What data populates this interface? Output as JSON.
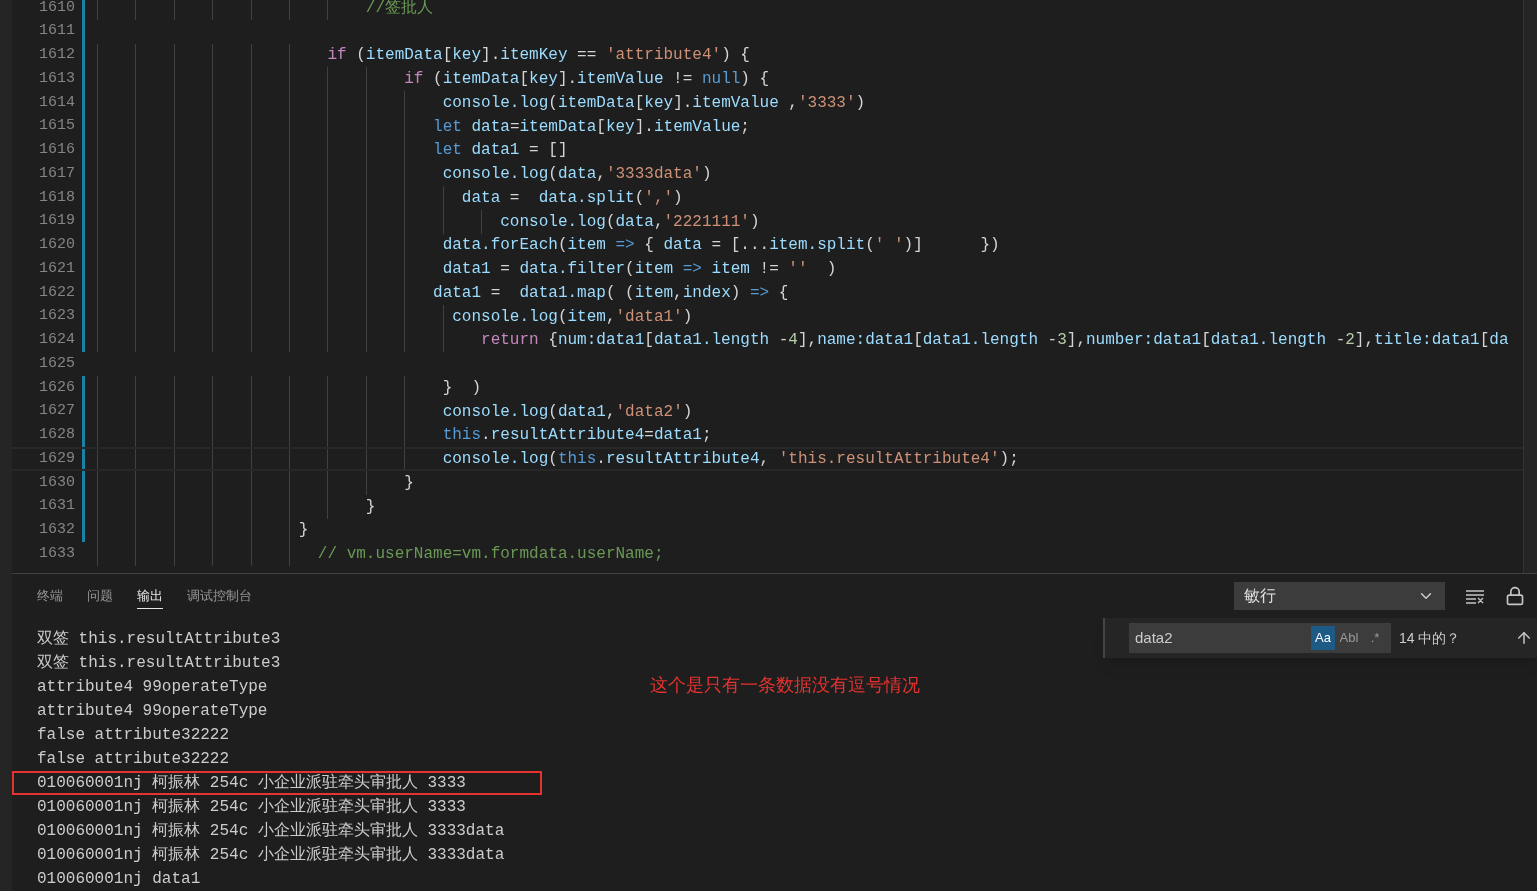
{
  "editor": {
    "lines": [
      {
        "n": "1610",
        "modified": true,
        "current": false,
        "code": [
          {
            "kind": "com",
            "text": "                            //签批人"
          }
        ]
      },
      {
        "n": "1611",
        "modified": true,
        "current": false
      },
      {
        "n": "1612",
        "modified": true,
        "current": false,
        "code": [
          {
            "kind": "kw",
            "text": "                        if"
          },
          {
            "kind": "p",
            "text": " ("
          },
          {
            "kind": "id",
            "text": "itemData"
          },
          {
            "kind": "p",
            "text": "["
          },
          {
            "kind": "id",
            "text": "key"
          },
          {
            "kind": "p",
            "text": "]."
          },
          {
            "kind": "id",
            "text": "itemKey"
          },
          {
            "kind": "p",
            "text": " == "
          },
          {
            "kind": "str",
            "text": "'attribute4'"
          },
          {
            "kind": "p",
            "text": ") {"
          }
        ]
      },
      {
        "n": "1613",
        "modified": true,
        "current": false,
        "code": [
          {
            "kind": "kw",
            "text": "                                if"
          },
          {
            "kind": "p",
            "text": " ("
          },
          {
            "kind": "id",
            "text": "itemData"
          },
          {
            "kind": "p",
            "text": "["
          },
          {
            "kind": "id",
            "text": "key"
          },
          {
            "kind": "p",
            "text": "]."
          },
          {
            "kind": "id",
            "text": "itemValue"
          },
          {
            "kind": "p",
            "text": " != "
          },
          {
            "kind": "dk",
            "text": "null"
          },
          {
            "kind": "p",
            "text": ") {"
          }
        ]
      },
      {
        "n": "1614",
        "modified": true,
        "current": false,
        "code": [
          {
            "kind": "id",
            "text": "                                    console.log"
          },
          {
            "kind": "p",
            "text": "("
          },
          {
            "kind": "id",
            "text": "itemData"
          },
          {
            "kind": "p",
            "text": "["
          },
          {
            "kind": "id",
            "text": "key"
          },
          {
            "kind": "p",
            "text": "]."
          },
          {
            "kind": "id",
            "text": "itemValue"
          },
          {
            "kind": "p",
            "text": " ,"
          },
          {
            "kind": "str",
            "text": "'3333'"
          },
          {
            "kind": "p",
            "text": ")"
          }
        ]
      },
      {
        "n": "1615",
        "modified": true,
        "current": false,
        "code": [
          {
            "kind": "dk",
            "text": "                                   let"
          },
          {
            "kind": "id",
            "text": " data"
          },
          {
            "kind": "p",
            "text": "="
          },
          {
            "kind": "id",
            "text": "itemData"
          },
          {
            "kind": "p",
            "text": "["
          },
          {
            "kind": "id",
            "text": "key"
          },
          {
            "kind": "p",
            "text": "]."
          },
          {
            "kind": "id",
            "text": "itemValue"
          },
          {
            "kind": "p",
            "text": ";"
          }
        ]
      },
      {
        "n": "1616",
        "modified": true,
        "current": false,
        "code": [
          {
            "kind": "dk",
            "text": "                                   let"
          },
          {
            "kind": "id",
            "text": " data1"
          },
          {
            "kind": "p",
            "text": " = []"
          }
        ]
      },
      {
        "n": "1617",
        "modified": true,
        "current": false,
        "code": [
          {
            "kind": "id",
            "text": "                                    console.log"
          },
          {
            "kind": "p",
            "text": "("
          },
          {
            "kind": "id",
            "text": "data"
          },
          {
            "kind": "p",
            "text": ","
          },
          {
            "kind": "str",
            "text": "'3333data'"
          },
          {
            "kind": "p",
            "text": ")"
          }
        ]
      },
      {
        "n": "1618",
        "modified": true,
        "current": false,
        "code": [
          {
            "kind": "id",
            "text": "                                      data"
          },
          {
            "kind": "p",
            "text": " =  "
          },
          {
            "kind": "id",
            "text": "data.split"
          },
          {
            "kind": "p",
            "text": "("
          },
          {
            "kind": "str",
            "text": "','"
          },
          {
            "kind": "p",
            "text": ")"
          }
        ]
      },
      {
        "n": "1619",
        "modified": true,
        "current": false,
        "code": [
          {
            "kind": "id",
            "text": "                                          console.log"
          },
          {
            "kind": "p",
            "text": "("
          },
          {
            "kind": "id",
            "text": "data"
          },
          {
            "kind": "p",
            "text": ","
          },
          {
            "kind": "str",
            "text": "'2221111'"
          },
          {
            "kind": "p",
            "text": ")"
          }
        ]
      },
      {
        "n": "1620",
        "modified": true,
        "current": false,
        "code": [
          {
            "kind": "id",
            "text": "                                    data.forEach"
          },
          {
            "kind": "p",
            "text": "("
          },
          {
            "kind": "id",
            "text": "item"
          },
          {
            "kind": "dk",
            "text": " =>"
          },
          {
            "kind": "p",
            "text": " { "
          },
          {
            "kind": "id",
            "text": "data"
          },
          {
            "kind": "p",
            "text": " = [..."
          },
          {
            "kind": "id",
            "text": "item.split"
          },
          {
            "kind": "p",
            "text": "("
          },
          {
            "kind": "str",
            "text": "' '"
          },
          {
            "kind": "p",
            "text": ")]      })"
          }
        ]
      },
      {
        "n": "1621",
        "modified": true,
        "current": false,
        "code": [
          {
            "kind": "id",
            "text": "                                    data1"
          },
          {
            "kind": "p",
            "text": " = "
          },
          {
            "kind": "id",
            "text": "data.filter"
          },
          {
            "kind": "p",
            "text": "("
          },
          {
            "kind": "id",
            "text": "item"
          },
          {
            "kind": "dk",
            "text": " =>"
          },
          {
            "kind": "id",
            "text": " item"
          },
          {
            "kind": "p",
            "text": " != "
          },
          {
            "kind": "str",
            "text": "''"
          },
          {
            "kind": "p",
            "text": "  )"
          }
        ]
      },
      {
        "n": "1622",
        "modified": true,
        "current": false,
        "code": [
          {
            "kind": "id",
            "text": "                                   data1"
          },
          {
            "kind": "p",
            "text": " =  "
          },
          {
            "kind": "id",
            "text": "data1.map"
          },
          {
            "kind": "p",
            "text": "( ("
          },
          {
            "kind": "id",
            "text": "item"
          },
          {
            "kind": "p",
            "text": ","
          },
          {
            "kind": "id",
            "text": "index"
          },
          {
            "kind": "p",
            "text": ") "
          },
          {
            "kind": "dk",
            "text": "=>"
          },
          {
            "kind": "p",
            "text": " {"
          }
        ]
      },
      {
        "n": "1623",
        "modified": true,
        "current": false,
        "code": [
          {
            "kind": "id",
            "text": "                                     console.log"
          },
          {
            "kind": "p",
            "text": "("
          },
          {
            "kind": "id",
            "text": "item"
          },
          {
            "kind": "p",
            "text": ","
          },
          {
            "kind": "str",
            "text": "'data1'"
          },
          {
            "kind": "p",
            "text": ")"
          }
        ]
      },
      {
        "n": "1624",
        "modified": true,
        "current": false,
        "code": [
          {
            "kind": "kw",
            "text": "                                        return"
          },
          {
            "kind": "p",
            "text": " {"
          },
          {
            "kind": "id",
            "text": "num:data1"
          },
          {
            "kind": "p",
            "text": "["
          },
          {
            "kind": "id",
            "text": "data1.length"
          },
          {
            "kind": "p",
            "text": " -"
          },
          {
            "kind": "num",
            "text": "4"
          },
          {
            "kind": "p",
            "text": "],"
          },
          {
            "kind": "id",
            "text": "name:data1"
          },
          {
            "kind": "p",
            "text": "["
          },
          {
            "kind": "id",
            "text": "data1.length"
          },
          {
            "kind": "p",
            "text": " -"
          },
          {
            "kind": "num",
            "text": "3"
          },
          {
            "kind": "p",
            "text": "],"
          },
          {
            "kind": "id",
            "text": "number:data1"
          },
          {
            "kind": "p",
            "text": "["
          },
          {
            "kind": "id",
            "text": "data1.length"
          },
          {
            "kind": "p",
            "text": " -"
          },
          {
            "kind": "num",
            "text": "2"
          },
          {
            "kind": "p",
            "text": "],"
          },
          {
            "kind": "id",
            "text": "title:data1"
          },
          {
            "kind": "p",
            "text": "["
          },
          {
            "kind": "id",
            "text": "da"
          }
        ]
      },
      {
        "n": "1625",
        "modified": false,
        "current": false
      },
      {
        "n": "1626",
        "modified": true,
        "current": false,
        "code": [
          {
            "kind": "p",
            "text": "                                    }  )"
          }
        ]
      },
      {
        "n": "1627",
        "modified": true,
        "current": false,
        "code": [
          {
            "kind": "id",
            "text": "                                    console.log"
          },
          {
            "kind": "p",
            "text": "("
          },
          {
            "kind": "id",
            "text": "data1"
          },
          {
            "kind": "p",
            "text": ","
          },
          {
            "kind": "str",
            "text": "'data2'"
          },
          {
            "kind": "p",
            "text": ")"
          }
        ]
      },
      {
        "n": "1628",
        "modified": true,
        "current": false,
        "code": [
          {
            "kind": "dk",
            "text": "                                    this"
          },
          {
            "kind": "p",
            "text": "."
          },
          {
            "kind": "id",
            "text": "resultAttribute4"
          },
          {
            "kind": "p",
            "text": "="
          },
          {
            "kind": "id",
            "text": "data1"
          },
          {
            "kind": "p",
            "text": ";"
          }
        ]
      },
      {
        "n": "1629",
        "modified": true,
        "current": true,
        "code": [
          {
            "kind": "id",
            "text": "                                    console.log"
          },
          {
            "kind": "p",
            "text": "("
          },
          {
            "kind": "dk",
            "text": "this"
          },
          {
            "kind": "p",
            "text": "."
          },
          {
            "kind": "id",
            "text": "resultAttribute4"
          },
          {
            "kind": "p",
            "text": ", "
          },
          {
            "kind": "str",
            "text": "'this.resultAttribute4'"
          },
          {
            "kind": "p",
            "text": ");"
          }
        ]
      },
      {
        "n": "1630",
        "modified": true,
        "current": false,
        "code": [
          {
            "kind": "p",
            "text": "                                }"
          }
        ]
      },
      {
        "n": "1631",
        "modified": true,
        "current": false,
        "code": [
          {
            "kind": "p",
            "text": "                            }"
          }
        ]
      },
      {
        "n": "1632",
        "modified": true,
        "current": false,
        "code": [
          {
            "kind": "p",
            "text": "                     }"
          }
        ]
      },
      {
        "n": "1633",
        "modified": false,
        "current": false,
        "code": [
          {
            "kind": "com",
            "text": "                       // vm.userName=vm.formdata.userName;"
          }
        ]
      }
    ]
  },
  "panel": {
    "tabs": [
      {
        "label": "终端",
        "selected": false
      },
      {
        "label": "问题",
        "selected": false
      },
      {
        "label": "输出",
        "selected": true
      },
      {
        "label": "调试控制台",
        "selected": false
      }
    ],
    "channel": "敏行",
    "find": {
      "value": "data2",
      "toggles": [
        {
          "label": "Aa",
          "on": true
        },
        {
          "label": "Abl",
          "on": false
        },
        {
          "label": ".*",
          "on": false
        }
      ],
      "count": "14 中的？"
    },
    "output": [
      {
        "text": "双签 this.resultAttribute3",
        "boxed": false
      },
      {
        "text": "双签 this.resultAttribute3",
        "boxed": false
      },
      {
        "text": "attribute4 99operateType",
        "boxed": false
      },
      {
        "text": "attribute4 99operateType",
        "boxed": false
      },
      {
        "text": "false attribute32222",
        "boxed": false
      },
      {
        "text": "false attribute32222",
        "boxed": false
      },
      {
        "text": "010060001nj 柯振林 254c 小企业派驻牵头审批人 3333",
        "boxed": true
      },
      {
        "text": "010060001nj 柯振林 254c 小企业派驻牵头审批人 3333",
        "boxed": false
      },
      {
        "text": "010060001nj 柯振林 254c 小企业派驻牵头审批人 3333data",
        "boxed": false
      },
      {
        "text": "010060001nj 柯振林 254c 小企业派驻牵头审批人 3333data",
        "boxed": false
      },
      {
        "text": "010060001nj data1",
        "boxed": false
      }
    ],
    "annotation": "这个是只有一条数据没有逗号情况"
  }
}
